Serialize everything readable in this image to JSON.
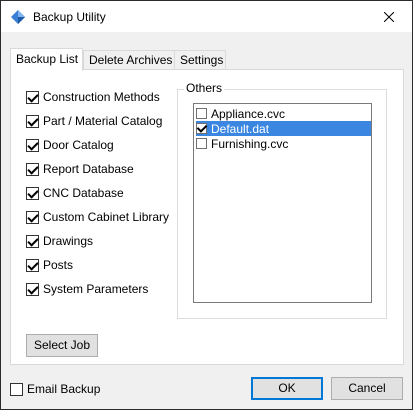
{
  "window": {
    "title": "Backup Utility"
  },
  "tabs": [
    {
      "label": "Backup List",
      "active": true
    },
    {
      "label": "Delete Archives",
      "active": false
    },
    {
      "label": "Settings",
      "active": false
    }
  ],
  "backup_items": [
    {
      "label": "Construction Methods",
      "checked": true
    },
    {
      "label": "Part / Material Catalog",
      "checked": true
    },
    {
      "label": "Door Catalog",
      "checked": true
    },
    {
      "label": "Report Database",
      "checked": true
    },
    {
      "label": "CNC Database",
      "checked": true
    },
    {
      "label": "Custom Cabinet Library",
      "checked": true
    },
    {
      "label": "Drawings",
      "checked": true
    },
    {
      "label": "Posts",
      "checked": true
    },
    {
      "label": "System Parameters",
      "checked": true
    }
  ],
  "others": {
    "legend": "Others",
    "items": [
      {
        "label": "Appliance.cvc",
        "checked": false,
        "selected": false
      },
      {
        "label": "Default.dat",
        "checked": true,
        "selected": true
      },
      {
        "label": "Furnishing.cvc",
        "checked": false,
        "selected": false
      }
    ]
  },
  "buttons": {
    "select_job": "Select Job",
    "ok": "OK",
    "cancel": "Cancel"
  },
  "email_backup": {
    "label": "Email Backup",
    "checked": false
  },
  "icons": {
    "app": "app-diamond-icon",
    "close": "close-icon"
  }
}
